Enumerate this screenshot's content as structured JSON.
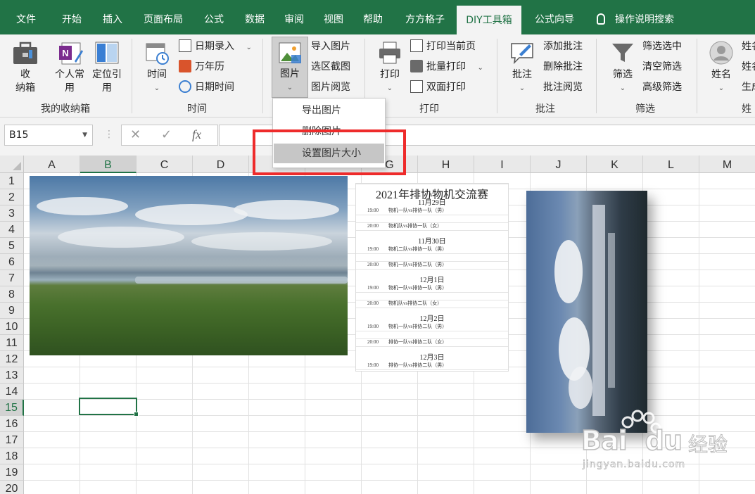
{
  "menu": {
    "tabs": [
      "文件",
      "开始",
      "插入",
      "页面布局",
      "公式",
      "数据",
      "审阅",
      "视图",
      "帮助",
      "方方格子",
      "DIY工具箱",
      "公式向导"
    ],
    "active_tab": "DIY工具箱",
    "search_label": "操作说明搜索"
  },
  "ribbon": {
    "groups": {
      "storage": {
        "label": "我的收纳箱",
        "storage_box": "收\n纳箱",
        "personal_common": "个人常\n用",
        "locate_ref": "定位引\n用"
      },
      "time": {
        "label": "时间",
        "time_btn": "时间",
        "date_input": "日期录入",
        "calendar": "万年历",
        "date_time": "日期时间"
      },
      "picture": {
        "picture_btn": "图片",
        "import_pic": "导入图片",
        "select_capture": "选区截图",
        "pic_browse": "图片阅览"
      },
      "print": {
        "label": "打印",
        "print_btn": "打印",
        "print_current": "打印当前页",
        "batch_print": "批量打印",
        "duplex_print": "双面打印"
      },
      "comment": {
        "label": "批注",
        "comment_btn": "批注",
        "add_comment": "添加批注",
        "delete_comment": "删除批注",
        "browse_comment": "批注阅览"
      },
      "filter": {
        "label": "筛选",
        "filter_btn": "筛选",
        "filter_selected": "筛选选中",
        "clear_filter": "清空筛选",
        "advanced_filter": "高级筛选"
      },
      "name": {
        "label": "姓",
        "name_btn": "姓名",
        "item1": "姓名",
        "item2": "姓名",
        "item3": "生成"
      }
    }
  },
  "dropdown": {
    "items": [
      "导出图片",
      "删除图片",
      "设置图片大小"
    ],
    "highlighted": "设置图片大小"
  },
  "formula_bar": {
    "name_box": "B15",
    "fx": "fx",
    "cancel": "✕",
    "confirm": "✓",
    "value": ""
  },
  "sheet": {
    "columns": [
      "A",
      "B",
      "C",
      "D",
      "E",
      "F",
      "G",
      "H",
      "I",
      "J",
      "K",
      "L",
      "M"
    ],
    "rows": [
      "1",
      "2",
      "3",
      "4",
      "5",
      "6",
      "7",
      "8",
      "9",
      "10",
      "11",
      "12",
      "13",
      "14",
      "15",
      "16",
      "17",
      "18",
      "19",
      "20"
    ],
    "selected_cell": "B15",
    "selected_column": "B",
    "selected_row": "15"
  },
  "schedule": {
    "title": "2021年排协物机交流赛",
    "days": [
      {
        "date": "11月29日",
        "games": [
          {
            "time": "19:00",
            "match": "物机一队vs排协一队（男）"
          },
          {
            "time": "20:00",
            "match": "物机队vs排协一队（女）"
          }
        ]
      },
      {
        "date": "11月30日",
        "games": [
          {
            "time": "19:00",
            "match": "物机二队vs排协一队（男）"
          },
          {
            "time": "20:00",
            "match": "物机一队vs排协二队（男）"
          }
        ]
      },
      {
        "date": "12月1日",
        "games": [
          {
            "time": "19:00",
            "match": "物机一队vs排协一队（男）"
          },
          {
            "time": "20:00",
            "match": "物机队vs排协二队（女）"
          }
        ]
      },
      {
        "date": "12月2日",
        "games": [
          {
            "time": "19:00",
            "match": "物机一队vs排协二队（男）"
          },
          {
            "time": "20:00",
            "match": "排协一队vs排协二队（女）"
          }
        ]
      },
      {
        "date": "12月3日",
        "games": [
          {
            "time": "19:00",
            "match": "排协一队vs排协二队（男）"
          }
        ]
      }
    ]
  },
  "watermark": {
    "brand": "Bai",
    "brand2": "du",
    "cn": "经验",
    "url": "jingyan.baidu.com"
  },
  "colors": {
    "excel_green": "#217346",
    "highlight_red": "#ee2b2b"
  }
}
